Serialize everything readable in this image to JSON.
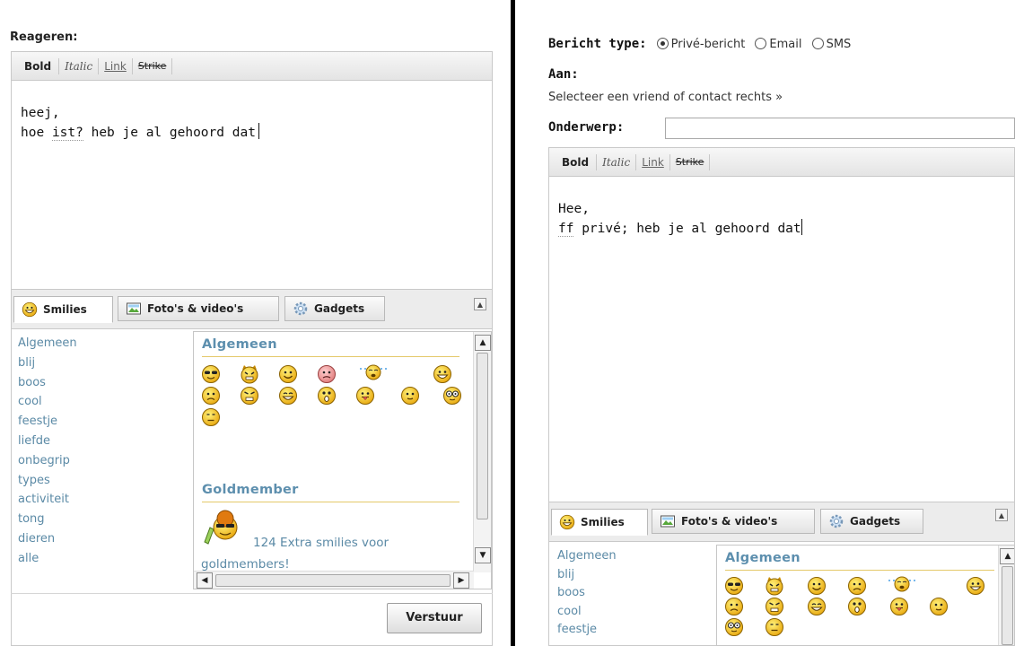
{
  "left": {
    "title": "Reageren:",
    "toolbar": {
      "bold": "Bold",
      "italic": "Italic",
      "link": "Link",
      "strike": "Strike"
    },
    "editor": {
      "line1": "heej,",
      "line2_word1": "hoe",
      "line2_word2": "ist?",
      "line2_rest": "heb je al gehoord dat"
    },
    "tabs": {
      "smilies": "Smilies",
      "photos": "Foto's & video's",
      "gadgets": "Gadgets"
    },
    "categories": [
      "Algemeen",
      "blij",
      "boos",
      "cool",
      "feestje",
      "liefde",
      "onbegrip",
      "types",
      "activiteit",
      "tong",
      "dieren",
      "alle"
    ],
    "pane_heading_general": "Algemeen",
    "pane_heading_gold": "Goldmember",
    "gold_text": "124 Extra smilies voor",
    "gold_text2": "goldmembers!",
    "send_label": "Verstuur"
  },
  "right": {
    "message_type_label": "Bericht type:",
    "options": {
      "private": "Privé-bericht",
      "email": "Email",
      "sms": "SMS"
    },
    "selected_option": "private",
    "to_label": "Aan:",
    "to_hint": "Selecteer een vriend of contact rechts »",
    "subject_label": "Onderwerp:",
    "subject_value": "",
    "toolbar": {
      "bold": "Bold",
      "italic": "Italic",
      "link": "Link",
      "strike": "Strike"
    },
    "editor": {
      "line1": "Hee,",
      "line2_word1": "ff",
      "line2_rest": "privé; heb je al gehoord dat"
    },
    "tabs": {
      "smilies": "Smilies",
      "photos": "Foto's & video's",
      "gadgets": "Gadgets"
    },
    "categories": [
      "Algemeen",
      "blij",
      "boos",
      "cool",
      "feestje"
    ],
    "pane_heading_general": "Algemeen"
  },
  "colors": {
    "link": "#5b8aa6",
    "heading": "#5d8fae",
    "rule": "#e4c96a",
    "smiley": "#f6c21c"
  }
}
